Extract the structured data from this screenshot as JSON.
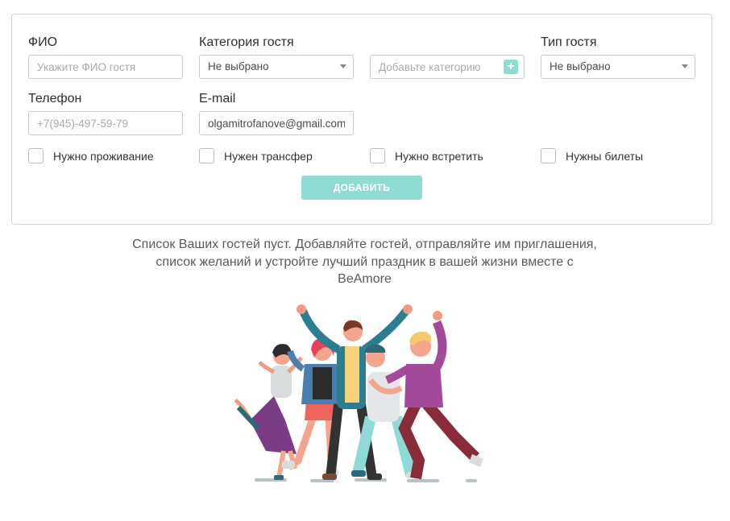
{
  "form": {
    "fio": {
      "label": "ФИО",
      "placeholder": "Укажите ФИО гостя"
    },
    "category": {
      "label": "Категория гостя",
      "selected": "Не выбрано"
    },
    "new_category": {
      "placeholder": "Добавьте категорию",
      "plus_icon": "+"
    },
    "guest_type": {
      "label": "Тип гостя",
      "selected": "Не выбрано"
    },
    "phone": {
      "label": "Телефон",
      "placeholder": "+7(945)-497-59-79"
    },
    "email": {
      "label": "E-mail",
      "value": "olgamitrofanove@gmail.com"
    },
    "checkboxes": [
      {
        "label": "Нужно проживание",
        "checked": false
      },
      {
        "label": "Нужен трансфер",
        "checked": false
      },
      {
        "label": "Нужно встретить",
        "checked": false
      },
      {
        "label": "Нужны билеты",
        "checked": false
      }
    ],
    "submit_label": "ДОБАВИТЬ"
  },
  "empty_state": {
    "line1": "Список Ваших гостей пуст. Добавляйте гостей, отправляйте им приглашения,",
    "line2": "список желаний и устройте лучший праздник в вашей жизни вместе с",
    "line3": "BeAmore"
  },
  "colors": {
    "accent": "#8fdcd3",
    "border": "#cfd3d6",
    "text": "#2f2f2f"
  }
}
